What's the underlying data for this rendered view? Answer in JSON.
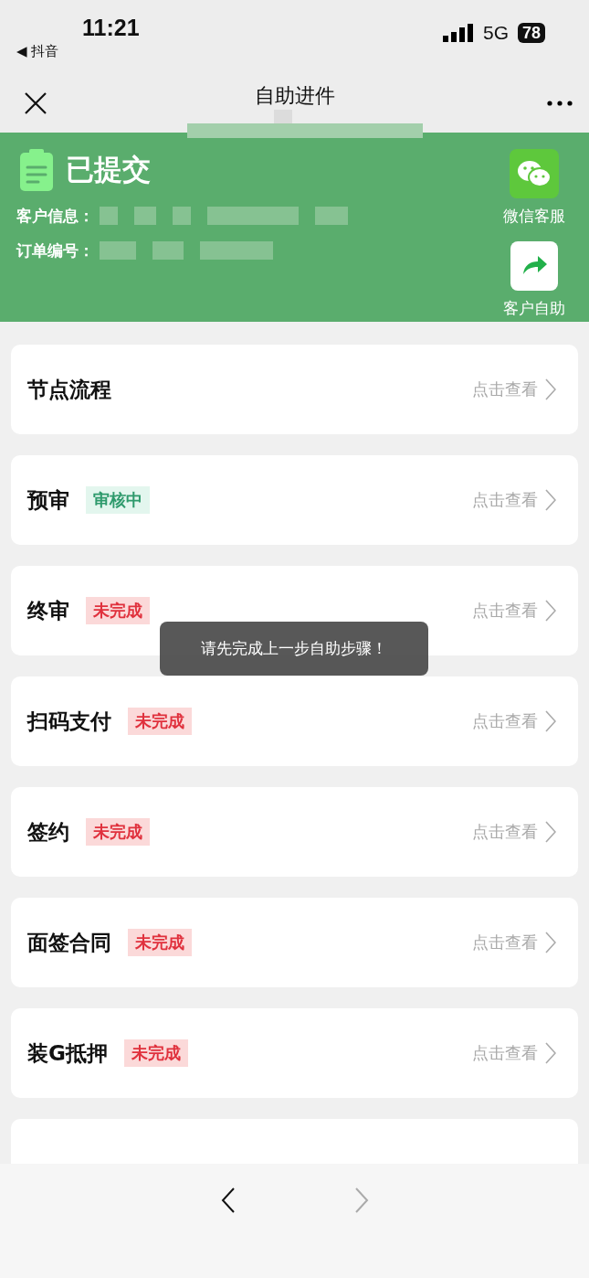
{
  "status_bar": {
    "time": "11:21",
    "back_app": "◀ 抖音",
    "network": "5G",
    "battery": "78"
  },
  "nav": {
    "title": "自助进件"
  },
  "header": {
    "status": "已提交",
    "fields": [
      {
        "label": "客户信息："
      },
      {
        "label": "订单编号："
      }
    ],
    "actions": [
      {
        "kind": "wechat",
        "label": "微信客服"
      },
      {
        "kind": "share",
        "label": "客户自助"
      }
    ]
  },
  "steps": [
    {
      "title": "节点流程",
      "link": "点击查看"
    },
    {
      "title": "预审",
      "tag": {
        "kind": "reviewing",
        "text": "审核中"
      },
      "link": "点击查看"
    },
    {
      "title": "终审",
      "tag": {
        "kind": "incomplete",
        "text": "未完成"
      },
      "link": "点击查看"
    },
    {
      "title": "扫码支付",
      "tag": {
        "kind": "incomplete",
        "text": "未完成"
      },
      "link": "点击查看"
    },
    {
      "title": "签约",
      "tag": {
        "kind": "incomplete",
        "text": "未完成"
      },
      "link": "点击查看"
    },
    {
      "title": "面签合同",
      "tag": {
        "kind": "incomplete",
        "text": "未完成"
      },
      "link": "点击查看"
    },
    {
      "title": "装G抵押",
      "tag": {
        "kind": "incomplete",
        "text": "未完成"
      },
      "link": "点击查看"
    }
  ],
  "toast": {
    "text": "请先完成上一步自助步骤！"
  },
  "bottom_nav": {
    "back_disabled": false,
    "forward_disabled": true
  }
}
